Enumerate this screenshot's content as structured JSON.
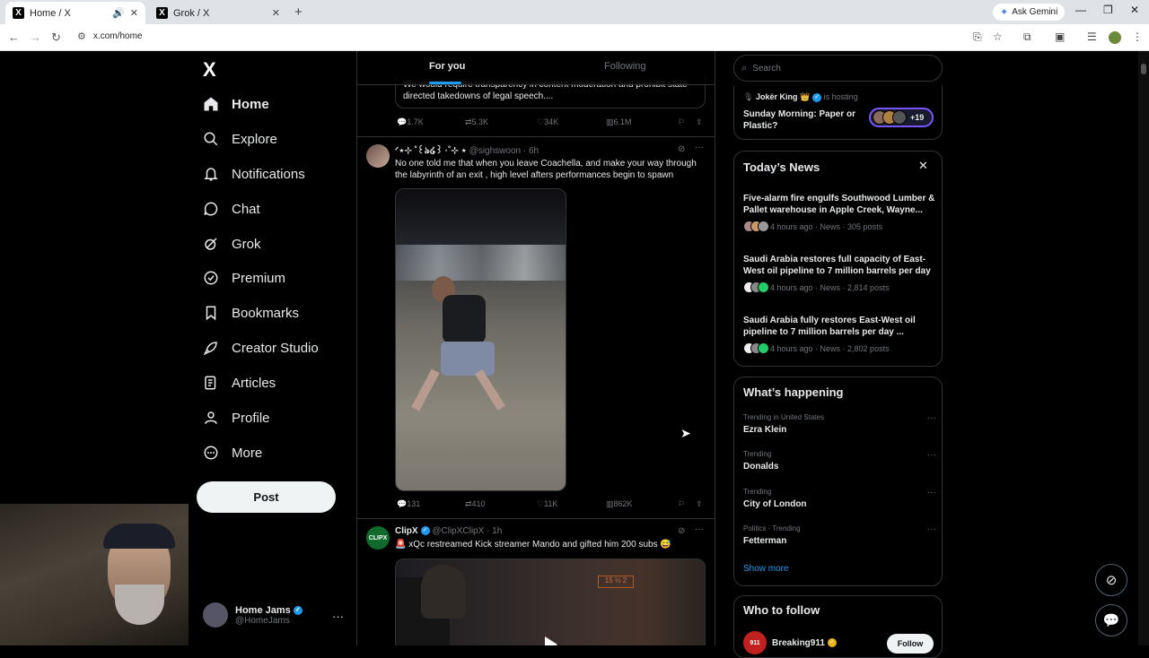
{
  "browser": {
    "tabs": [
      {
        "title": "Home / X",
        "active": true
      },
      {
        "title": "Grok / X",
        "active": false
      }
    ],
    "new_tab": "+",
    "gemini": "Ask Gemini",
    "url": "x.com/home"
  },
  "nav": {
    "logo": "X",
    "items": [
      {
        "label": "Home",
        "icon": "home-icon"
      },
      {
        "label": "Explore",
        "icon": "search-icon"
      },
      {
        "label": "Notifications",
        "icon": "bell-icon"
      },
      {
        "label": "Chat",
        "icon": "chat-icon"
      },
      {
        "label": "Grok",
        "icon": "grok-icon"
      },
      {
        "label": "Premium",
        "icon": "premium-icon"
      },
      {
        "label": "Bookmarks",
        "icon": "bookmark-icon"
      },
      {
        "label": "Creator Studio",
        "icon": "rocket-icon"
      },
      {
        "label": "Articles",
        "icon": "articles-icon"
      },
      {
        "label": "Profile",
        "icon": "profile-icon"
      },
      {
        "label": "More",
        "icon": "more-circle-icon"
      }
    ],
    "post_label": "Post",
    "account": {
      "name": "Home Jams",
      "handle": "@HomeJams"
    }
  },
  "feed": {
    "tabs": [
      "For you",
      "Following"
    ],
    "quote_text": "We would require transparency in content moderation and prohibit state-directed takedowns of legal speech....",
    "tweet0_stats": {
      "replies": "1.7K",
      "reposts": "5.3K",
      "likes": "34K",
      "views": "6.1M"
    },
    "tweet1": {
      "name": "ᐟ⋆⊹ ˚꒰ঌ໒꒱ ·˚⊹ ⋆",
      "handle": "@sighswoon",
      "time": "· 6h",
      "text": "No one told me that when you leave Coachella, and make your way through the labyrinth of an exit , high level afters performances begin to spawn",
      "replies": "131",
      "reposts": "410",
      "likes": "11K",
      "views": "862K"
    },
    "tweet2": {
      "name": "ClipX",
      "handle": "@ClipXClipX",
      "time": "· 1h",
      "text": "🚨 xQc restreamed Kick streamer Mando and gifted him 200 subs 😅",
      "avatar_text": "CLIPX",
      "sign_text": "15 ½ 2"
    }
  },
  "right": {
    "search_placeholder": "Search",
    "space": {
      "host": "Jokër King 👑",
      "status": "is hosting",
      "title": "Sunday Morning: Paper or Plastic?",
      "count": "+19"
    },
    "news": {
      "title": "Today’s News",
      "items": [
        {
          "headline": "Five-alarm fire engulfs Southwood Lumber & Pallet warehouse in Apple Creek, Wayne...",
          "meta": "4 hours ago · News · 305 posts"
        },
        {
          "headline": "Saudi Arabia restores full capacity of East-West oil pipeline to 7 million barrels per day",
          "meta": "4 hours ago · News · 2,814 posts"
        },
        {
          "headline": "Saudi Arabia fully restores East-West oil pipeline to 7 million barrels per day ...",
          "meta": "4 hours ago · News · 2,802 posts"
        }
      ]
    },
    "happening": {
      "title": "What’s happening",
      "trends": [
        {
          "context": "Trending in United States",
          "name": "Ezra Klein"
        },
        {
          "context": "Trending",
          "name": "Donalds"
        },
        {
          "context": "Trending",
          "name": "City of London"
        },
        {
          "context": "Politics · Trending",
          "name": "Fetterman"
        }
      ],
      "show_more": "Show more"
    },
    "who_to_follow": {
      "title": "Who to follow",
      "account": "Breaking911",
      "avatar_text": "911",
      "follow_label": "Follow"
    }
  }
}
